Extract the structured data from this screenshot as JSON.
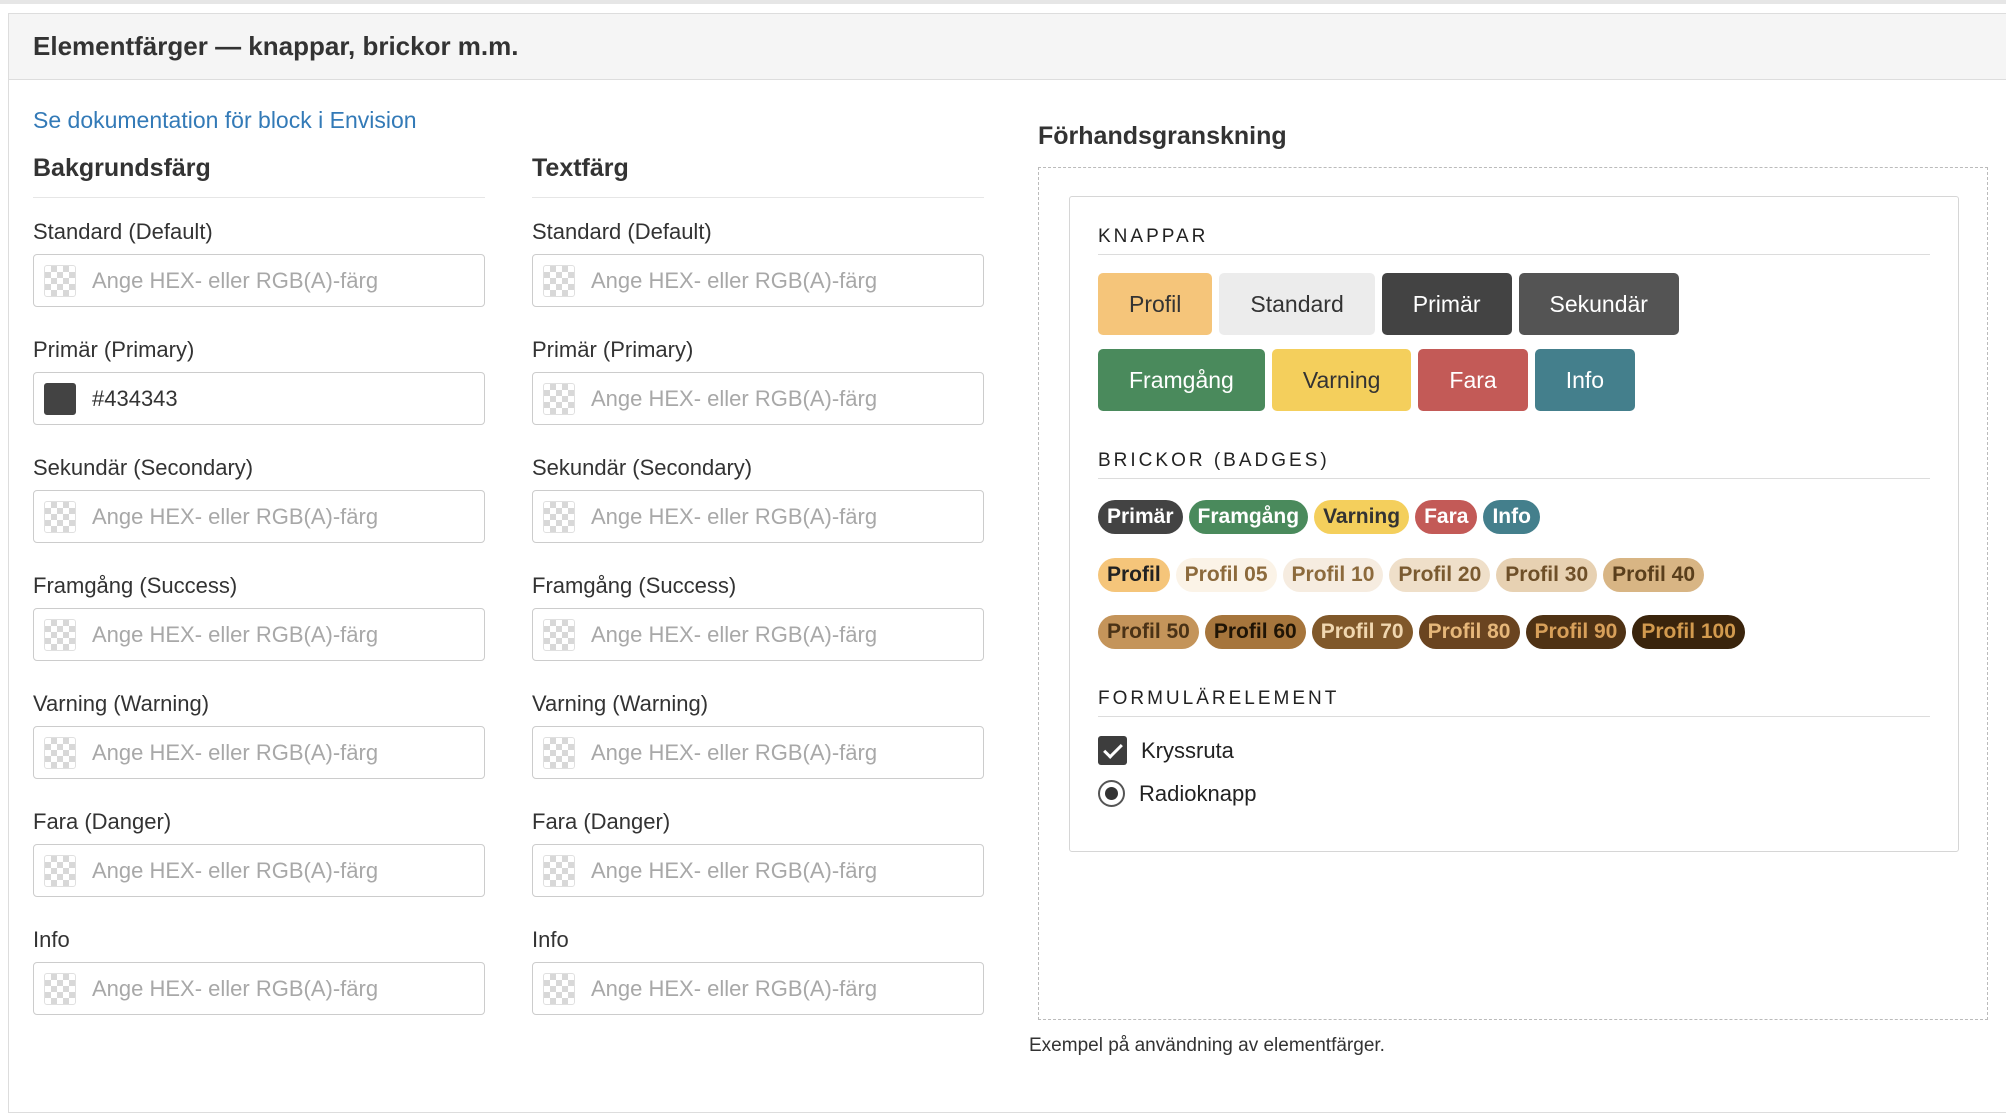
{
  "panel": {
    "title": "Elementfärger — knappar, brickor m.m."
  },
  "doc_link": "Se dokumentation för block i Envision",
  "background_column": {
    "title": "Bakgrundsfärg",
    "fields": [
      {
        "label": "Standard (Default)",
        "value": "",
        "placeholder": "Ange HEX- eller RGB(A)-färg"
      },
      {
        "label": "Primär (Primary)",
        "value": "#434343",
        "placeholder": "Ange HEX- eller RGB(A)-färg"
      },
      {
        "label": "Sekundär (Secondary)",
        "value": "",
        "placeholder": "Ange HEX- eller RGB(A)-färg"
      },
      {
        "label": "Framgång (Success)",
        "value": "",
        "placeholder": "Ange HEX- eller RGB(A)-färg"
      },
      {
        "label": "Varning (Warning)",
        "value": "",
        "placeholder": "Ange HEX- eller RGB(A)-färg"
      },
      {
        "label": "Fara (Danger)",
        "value": "",
        "placeholder": "Ange HEX- eller RGB(A)-färg"
      },
      {
        "label": "Info",
        "value": "",
        "placeholder": "Ange HEX- eller RGB(A)-färg"
      }
    ]
  },
  "text_column": {
    "title": "Textfärg",
    "fields": [
      {
        "label": "Standard (Default)",
        "value": "",
        "placeholder": "Ange HEX- eller RGB(A)-färg"
      },
      {
        "label": "Primär (Primary)",
        "value": "",
        "placeholder": "Ange HEX- eller RGB(A)-färg"
      },
      {
        "label": "Sekundär (Secondary)",
        "value": "",
        "placeholder": "Ange HEX- eller RGB(A)-färg"
      },
      {
        "label": "Framgång (Success)",
        "value": "",
        "placeholder": "Ange HEX- eller RGB(A)-färg"
      },
      {
        "label": "Varning (Warning)",
        "value": "",
        "placeholder": "Ange HEX- eller RGB(A)-färg"
      },
      {
        "label": "Fara (Danger)",
        "value": "",
        "placeholder": "Ange HEX- eller RGB(A)-färg"
      },
      {
        "label": "Info",
        "value": "",
        "placeholder": "Ange HEX- eller RGB(A)-färg"
      }
    ]
  },
  "preview": {
    "title": "Förhandsgranskning",
    "buttons_heading": "KNAPPAR",
    "buttons": [
      {
        "label": "Profil",
        "bg": "#f5c57a",
        "fg": "#333333"
      },
      {
        "label": "Standard",
        "bg": "#ececec",
        "fg": "#333333"
      },
      {
        "label": "Primär",
        "bg": "#434343",
        "fg": "#ffffff"
      },
      {
        "label": "Sekundär",
        "bg": "#545454",
        "fg": "#ffffff"
      },
      {
        "label": "Framgång",
        "bg": "#4a8a5c",
        "fg": "#ffffff"
      },
      {
        "label": "Varning",
        "bg": "#f4cf5c",
        "fg": "#333333"
      },
      {
        "label": "Fara",
        "bg": "#c35a57",
        "fg": "#ffffff"
      },
      {
        "label": "Info",
        "bg": "#447f8c",
        "fg": "#ffffff"
      }
    ],
    "badges_heading": "BRICKOR (BADGES)",
    "badges": [
      {
        "label": "Primär",
        "bg": "#434343",
        "fg": "#ffffff"
      },
      {
        "label": "Framgång",
        "bg": "#4a8a5c",
        "fg": "#ffffff"
      },
      {
        "label": "Varning",
        "bg": "#f4cf5c",
        "fg": "#333333"
      },
      {
        "label": "Fara",
        "bg": "#c35a57",
        "fg": "#ffffff"
      },
      {
        "label": "Info",
        "bg": "#447f8c",
        "fg": "#ffffff"
      },
      {
        "label": "Profil",
        "bg": "#f5c57a",
        "fg": "#222222"
      },
      {
        "label": "Profil 05",
        "bg": "#fbf3e7",
        "fg": "#8c6a3c"
      },
      {
        "label": "Profil 10",
        "bg": "#f6ece0",
        "fg": "#8c6a3c"
      },
      {
        "label": "Profil 20",
        "bg": "#efdfc9",
        "fg": "#7a5a30"
      },
      {
        "label": "Profil 30",
        "bg": "#e7d1b2",
        "fg": "#6e4f28"
      },
      {
        "label": "Profil 40",
        "bg": "#d8b584",
        "fg": "#5a3f1c"
      },
      {
        "label": "Profil 50",
        "bg": "#c4945a",
        "fg": "#4a3216"
      },
      {
        "label": "Profil 60",
        "bg": "#a6753c",
        "fg": "#1f1405"
      },
      {
        "label": "Profil 70",
        "bg": "#80582a",
        "fg": "#f0d7b0"
      },
      {
        "label": "Profil 80",
        "bg": "#6a4420",
        "fg": "#e6b77a"
      },
      {
        "label": "Profil 90",
        "bg": "#4f3214",
        "fg": "#d8a05a"
      },
      {
        "label": "Profil 100",
        "bg": "#3a240c",
        "fg": "#d29a4e"
      }
    ],
    "form_heading": "FORMULÄRELEMENT",
    "checkbox_label": "Kryssruta",
    "radio_label": "Radioknapp"
  },
  "caption": "Exempel på användning av elementfärger."
}
